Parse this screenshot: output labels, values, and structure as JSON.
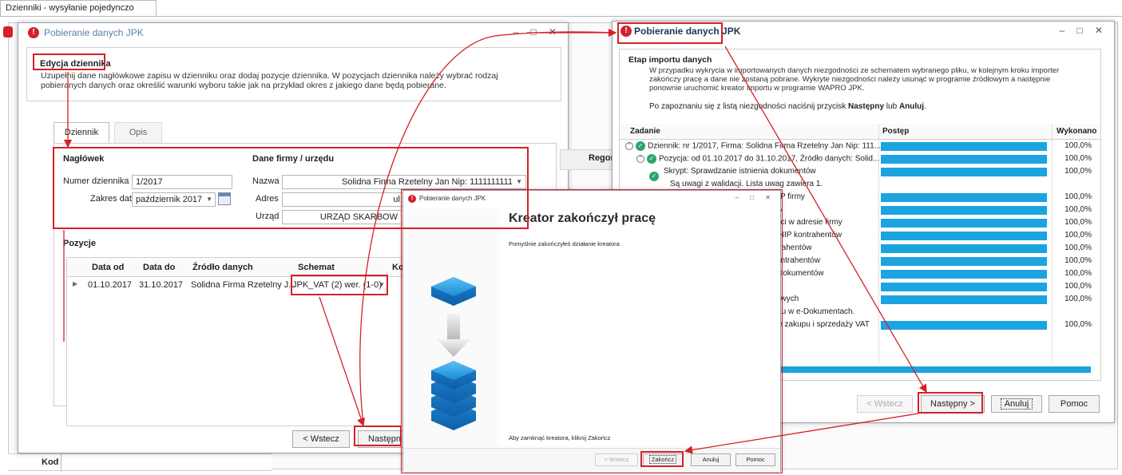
{
  "app": {
    "tab_title": "Dzienniki - wysyłanie pojedynczo",
    "bottom_label": "Kod"
  },
  "left_window": {
    "title": "Pobieranie danych JPK",
    "controls": "– □ ✕",
    "section_title": "Edycja dziennika",
    "description": "Uzupełnij dane nagłówkowe zapisu w dzienniku oraz dodaj pozycje dziennika. W pozycjach dziennika należy wybrać rodzaj pobieranych danych oraz określić warunki wyboru takie jak na przykład okres z jakiego dane będą pobierane.",
    "tabs": [
      "Dziennik",
      "Opis"
    ],
    "header_label": "Nagłówek",
    "company_label": "Dane firmy / urzędu",
    "fields": {
      "numer_label": "Numer dziennika",
      "numer_value": "1/2017",
      "zakres_label": "Zakres dat",
      "zakres_value": "październik 2017",
      "nazwa_label": "Nazwa",
      "nazwa_value": "Solidna Firma Rzetelny Jan Nip: 1111111111",
      "adres_label": "Adres",
      "adres_value": "ul. Krótka 3",
      "urzad_label": "Urząd",
      "urzad_value": "URZĄD SKARBOW"
    },
    "pozycje_label": "Pozycje",
    "grid_headers": [
      "Data od",
      "Data do",
      "Źródło danych",
      "Schemat",
      "Ko"
    ],
    "grid_row": {
      "data_od": "01.10.2017",
      "data_do": "31.10.2017",
      "zrodlo": "Solidna Firma Rzetelny J...",
      "schemat": "JPK_VAT (2) wer. (1-0)"
    },
    "side_label": "Regon",
    "back_button": "< Wstecz",
    "next_button": "Następn"
  },
  "right_window": {
    "title": "Pobieranie danych JPK",
    "controls": "– □ ✕",
    "stage_title": "Etap importu danych",
    "description": "W przypadku wykrycia w importowanych danych niezgodności ze schematem wybranego pliku, w kolejnym kroku importer zakończy pracę a dane nie zostaną pobrane. Wykryte niezgodności należy usunąć w programie źródłowym a następnie ponownie uruchomić kreator importu w programie WAPRO JPK.",
    "hint_prefix": "Po zapoznaniu się z listą niezgodności naciśnij przycisk ",
    "hint_next": "Następny",
    "hint_mid": " lub ",
    "hint_cancel": "Anuluj",
    "hint_suffix": ".",
    "columns": [
      "Zadanie",
      "Postęp",
      "Wykonano"
    ],
    "rows": [
      {
        "task": "Dziennik: nr 1/2017, Firma: Solidna Firma Rzetelny Jan Nip: 111...",
        "pct": "100,0%"
      },
      {
        "task": "Pozycja: od 01.10.2017 do 31.10.2017, Źródło danych: Solid...",
        "pct": "100,0%"
      },
      {
        "task": "Skrypt: Sprawdzanie istnienia dokumentów",
        "pct": "100,0%"
      },
      {
        "task": "Są uwagi z walidacji. Lista uwag zawiera 1."
      },
      {
        "task": "NIP firmy",
        "pct": "100,0%"
      },
      {
        "task": "my",
        "pct": "100,0%"
      },
      {
        "task": "ości w adresie firmy",
        "pct": "100,0%"
      },
      {
        "task": "v NIP kontrahentów",
        "pct": "100,0%"
      },
      {
        "task": "ntrahentów",
        "pct": "100,0%"
      },
      {
        "task": "kontrahentów",
        "pct": "100,0%"
      },
      {
        "task": "v dokumentów",
        "pct": "100,0%"
      },
      {
        "task": "",
        "pct": "100,0%"
      },
      {
        "task": "kowych",
        "pct": "100,0%"
      },
      {
        "task": "ortu w e-Dokumentach."
      },
      {
        "task": "cje zakupu i sprzedaży VAT",
        "pct": "100,0%"
      }
    ],
    "back_button": "< Wstecz",
    "next_button": "Następny >",
    "cancel_button": "Anuluj",
    "help_button": "Pomoc"
  },
  "center_window": {
    "title": "Pobieranie danych JPK",
    "controls": "– □ ✕",
    "heading": "Kreator zakończył pracę",
    "message": "Pomyślnie zakończyłeś działanie kreatora",
    "footer_hint": "Aby zamknąć kreatora, kliknij Zakończ",
    "back_button": "< Wstecz",
    "finish_button": "Zakończ",
    "cancel_button": "Anuluj",
    "help_button": "Pomoc"
  },
  "colors": {
    "accent_red": "#d4212a",
    "progress_blue": "#1ca4e0",
    "cube_blue": "#1e90d8"
  }
}
